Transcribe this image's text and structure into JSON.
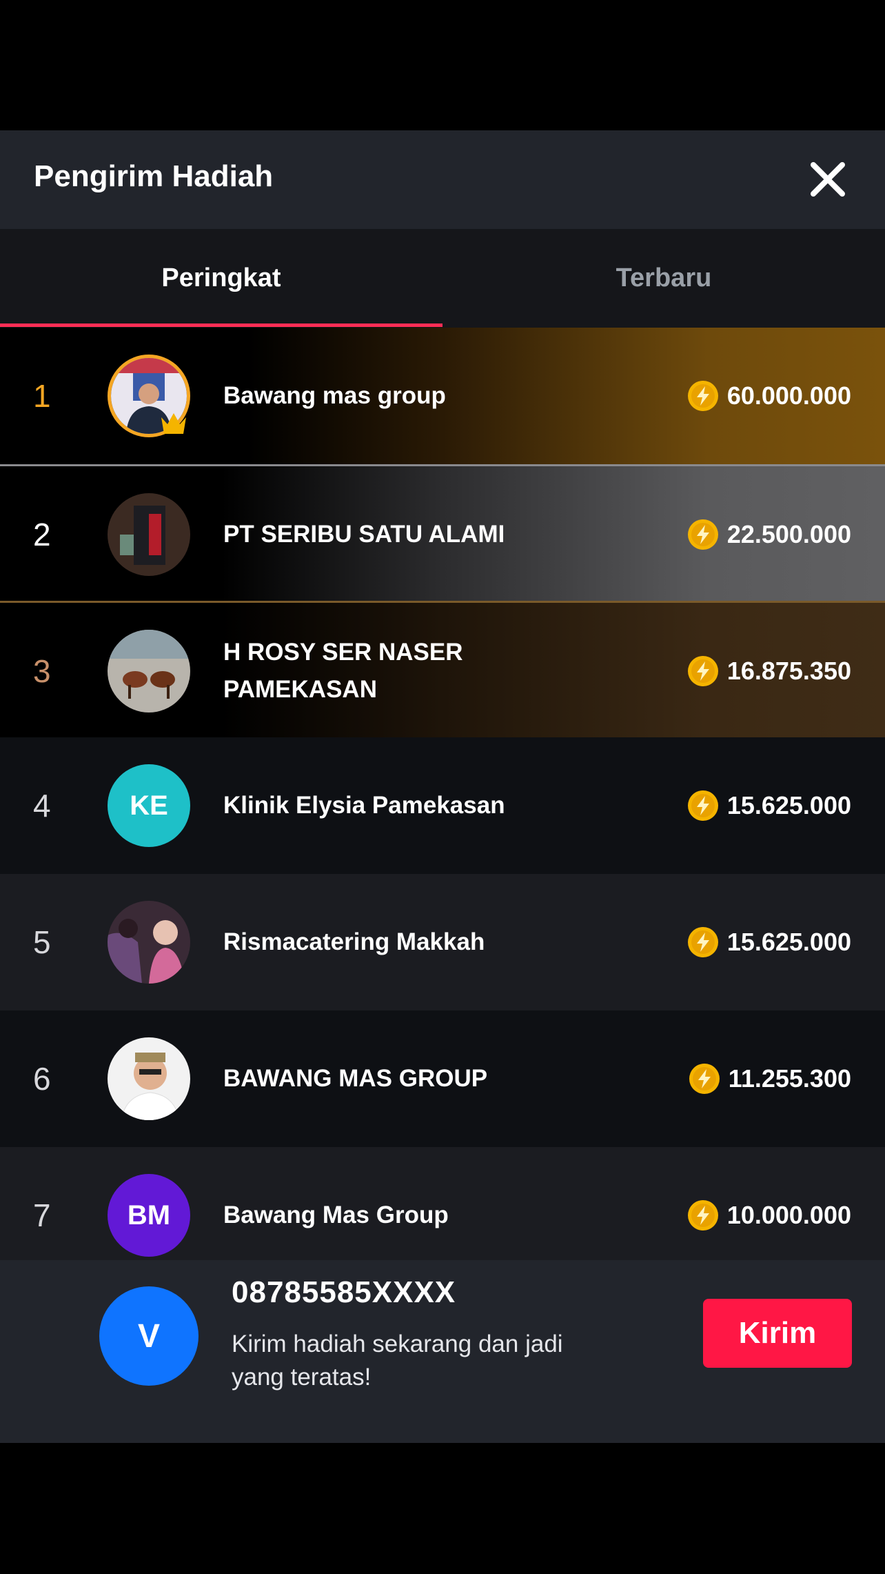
{
  "modal": {
    "title": "Pengirim Hadiah",
    "close_icon": "close-icon"
  },
  "tabs": [
    {
      "label": "Peringkat",
      "active": true
    },
    {
      "label": "Terbaru",
      "active": false
    }
  ],
  "leaderboard": [
    {
      "rank": "1",
      "name": "Bawang mas group",
      "amount": "60.000.000",
      "avatar": "photo",
      "badge": "crown-icon",
      "rank_color": "#f5a623"
    },
    {
      "rank": "2",
      "name": "PT SERIBU SATU ALAMI",
      "amount": "22.500.000",
      "avatar": "photo",
      "rank_color": "#ffffff"
    },
    {
      "rank": "3",
      "name": "H ROSY SER NASER PAMEKASAN",
      "amount": "16.875.350",
      "avatar": "photo",
      "rank_color": "#c8906a"
    },
    {
      "rank": "4",
      "name": "Klinik Elysia Pamekasan",
      "amount": "15.625.000",
      "avatar_initials": "KE",
      "avatar_color": "#1ec0c8"
    },
    {
      "rank": "5",
      "name": "Rismacatering Makkah",
      "amount": "15.625.000",
      "avatar": "photo"
    },
    {
      "rank": "6",
      "name": "BAWANG MAS GROUP",
      "amount": "11.255.300",
      "avatar": "photo"
    },
    {
      "rank": "7",
      "name": "Bawang Mas Group",
      "amount": "10.000.000",
      "avatar_initials": "BM",
      "avatar_color": "#6219d6"
    }
  ],
  "footer": {
    "avatar_initial": "V",
    "user_id": "08785585XXXX",
    "message": "Kirim hadiah sekarang dan jadi yang teratas!",
    "send_label": "Kirim"
  },
  "colors": {
    "accent": "#ff1745",
    "tab_indicator": "#ff2d55",
    "coin": "#f5b400",
    "gold": "#f5a623"
  }
}
